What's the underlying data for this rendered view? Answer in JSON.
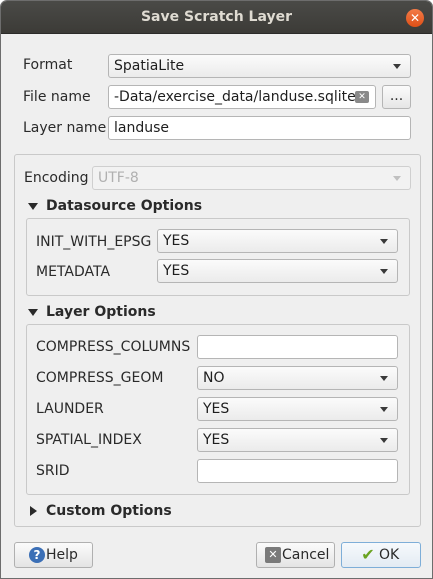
{
  "window": {
    "title": "Save Scratch Layer"
  },
  "form": {
    "format_label": "Format",
    "format_value": "SpatiaLite",
    "file_label": "File name",
    "file_value": "-Data/exercise_data/landuse.sqlite",
    "browse_label": "...",
    "layer_label": "Layer name",
    "layer_value": "landuse"
  },
  "encoding": {
    "label": "Encoding",
    "value": "UTF-8"
  },
  "datasource": {
    "title": "Datasource Options",
    "rows": [
      {
        "label": "INIT_WITH_EPSG",
        "value": "YES"
      },
      {
        "label": "METADATA",
        "value": "YES"
      }
    ]
  },
  "layer_options": {
    "title": "Layer Options",
    "rows": [
      {
        "label": "COMPRESS_COLUMNS",
        "value": ""
      },
      {
        "label": "COMPRESS_GEOM",
        "value": "NO"
      },
      {
        "label": "LAUNDER",
        "value": "YES"
      },
      {
        "label": "SPATIAL_INDEX",
        "value": "YES"
      },
      {
        "label": "SRID",
        "value": ""
      }
    ]
  },
  "custom_options": {
    "title": "Custom Options"
  },
  "buttons": {
    "help": "Help",
    "cancel": "Cancel",
    "ok": "OK"
  }
}
